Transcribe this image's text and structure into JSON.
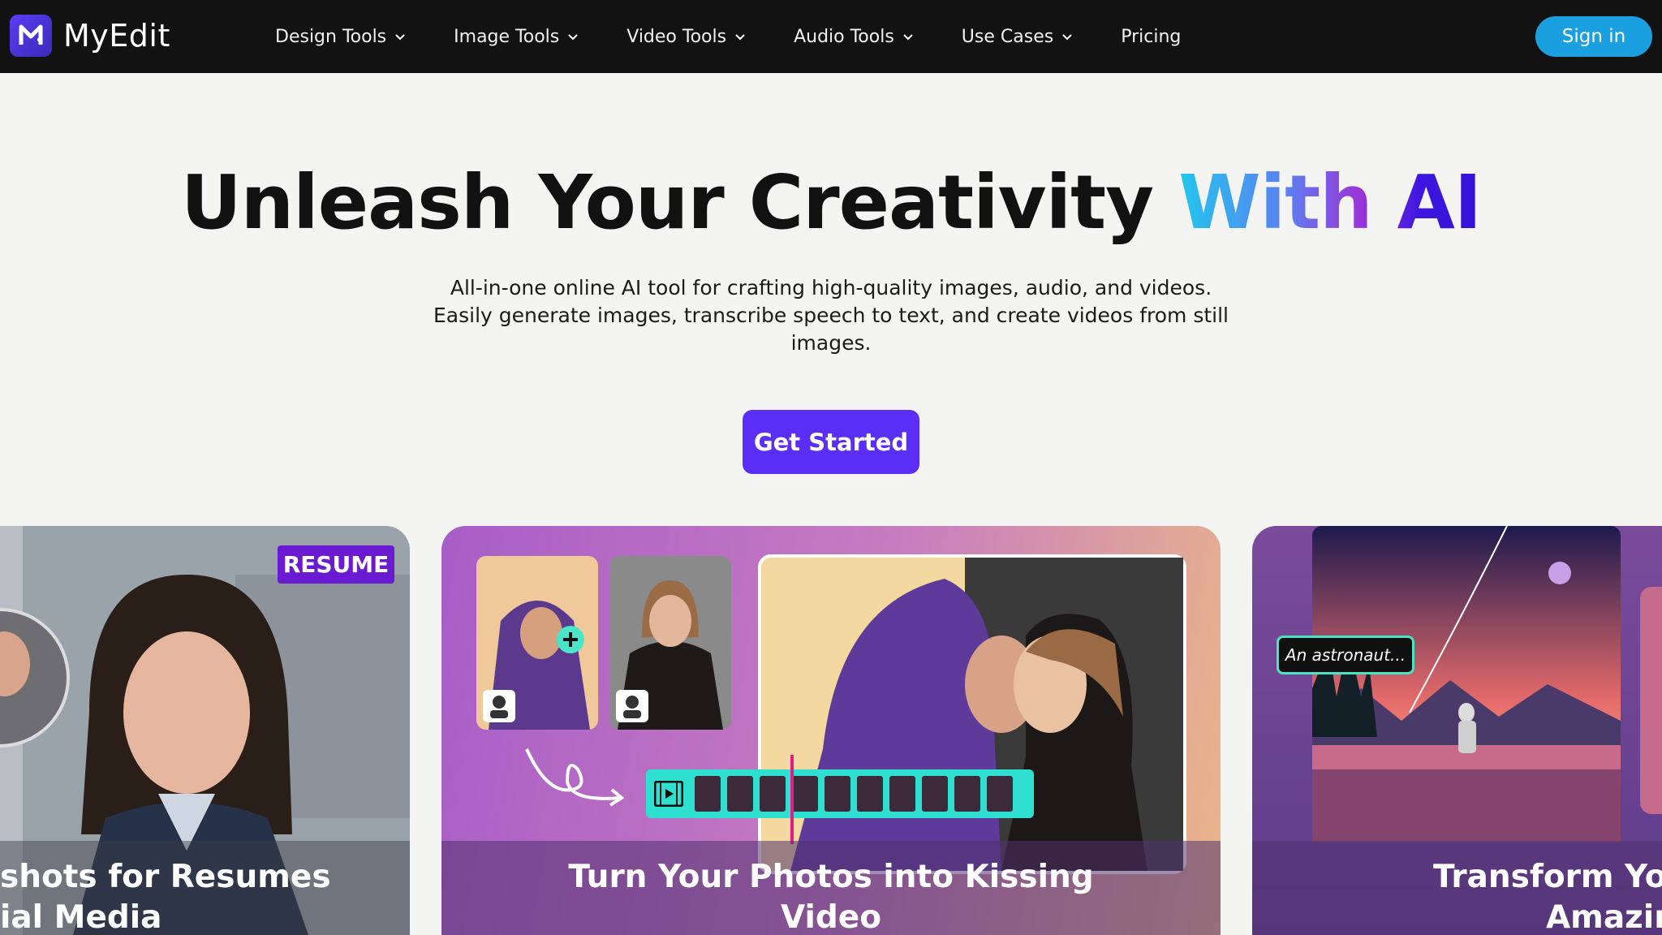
{
  "brand": {
    "name": "MyEdit"
  },
  "nav": {
    "items": [
      {
        "label": "Design Tools",
        "dropdown": true
      },
      {
        "label": "Image Tools",
        "dropdown": true
      },
      {
        "label": "Video Tools",
        "dropdown": true
      },
      {
        "label": "Audio Tools",
        "dropdown": true
      },
      {
        "label": "Use Cases",
        "dropdown": true
      },
      {
        "label": "Pricing",
        "dropdown": false
      }
    ],
    "signin_label": "Sign in"
  },
  "hero": {
    "title_plain": "Unleash Your Creativity ",
    "title_accent": "With AI",
    "subtitle": "All-in-one online AI tool for crafting high-quality images, audio, and videos. Easily generate images, transcribe speech to text, and create videos from still images.",
    "cta_label": "Get Started"
  },
  "cards": {
    "left": {
      "badge": "RESUME",
      "caption_line1": "shots for Resumes",
      "caption_line2": "ial Media"
    },
    "middle": {
      "caption_line1": "Turn Your Photos into Kissing",
      "caption_line2": "Video"
    },
    "right": {
      "prompt_chip": "An astronaut...",
      "caption_line1": "Transform You",
      "caption_line2": "Amazin"
    }
  },
  "colors": {
    "accent": "#5a2ef5",
    "signin": "#1aa0e0",
    "nav_bg": "#121212"
  }
}
